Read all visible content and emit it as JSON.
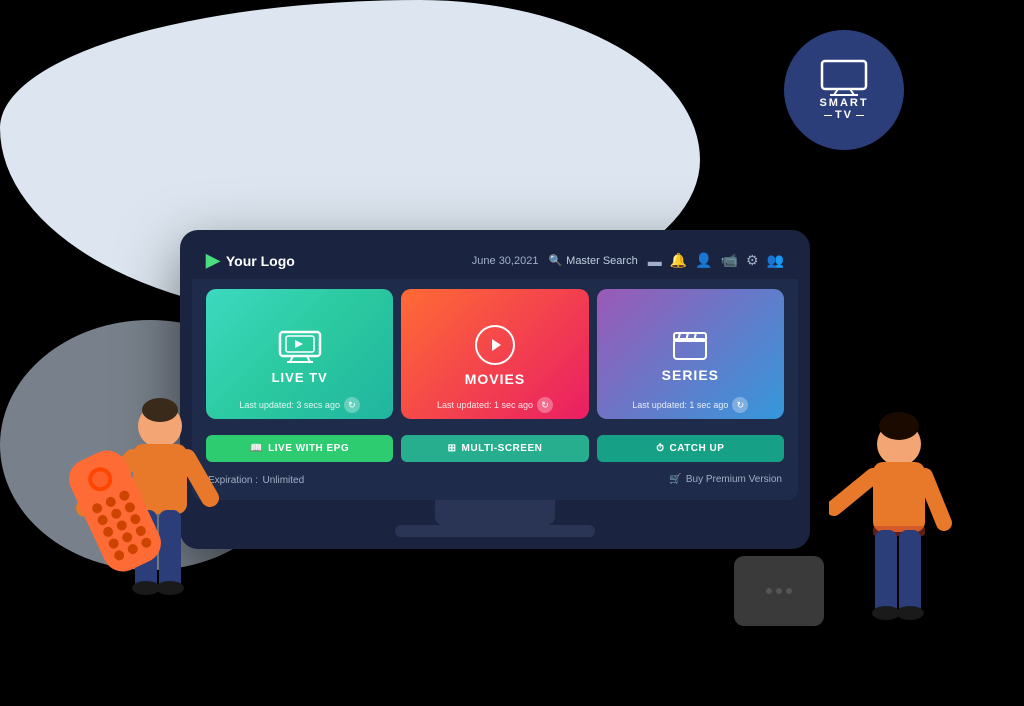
{
  "page": {
    "background": "#000000"
  },
  "smart_tv_badge": {
    "line1": "SMART",
    "line2": "TV"
  },
  "tv_header": {
    "logo_text": "Your Logo",
    "date": "June 30,2021",
    "search_label": "Master Search",
    "icons": [
      "card-icon",
      "bell-icon",
      "user-icon",
      "camera-icon",
      "gear-icon",
      "user-plus-icon"
    ]
  },
  "cards": [
    {
      "id": "live-tv",
      "title": "LIVE TV",
      "update_text": "Last updated: 3 secs ago"
    },
    {
      "id": "movies",
      "title": "MOVIES",
      "update_text": "Last updated: 1 sec ago"
    },
    {
      "id": "series",
      "title": "SERIES",
      "update_text": "Last updated: 1 sec ago"
    }
  ],
  "bottom_buttons": [
    {
      "id": "epg",
      "label": "LIVE WITH EPG",
      "icon": "book-icon"
    },
    {
      "id": "multiscreen",
      "label": "MULTI-SCREEN",
      "icon": "grid-icon"
    },
    {
      "id": "catchup",
      "label": "CATCH UP",
      "icon": "clock-icon"
    }
  ],
  "footer": {
    "expiration_label": "Expiration :",
    "expiration_value": "Unlimited",
    "buy_label": "Buy Premium Version"
  }
}
